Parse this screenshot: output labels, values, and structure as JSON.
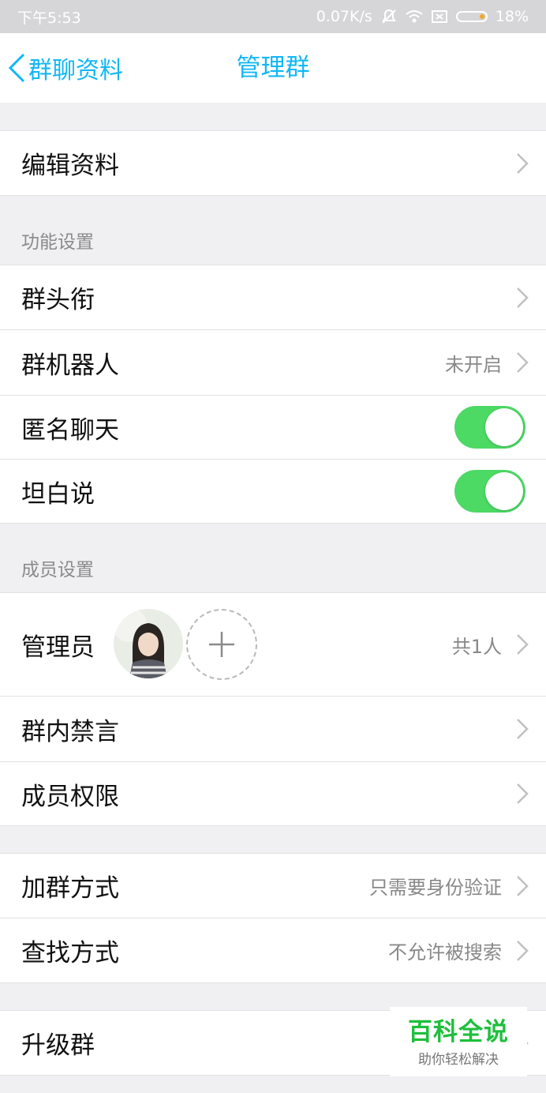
{
  "status_bar": {
    "time": "下午5:53",
    "network_speed": "0.07K/s",
    "battery_percent": "18%",
    "icons": [
      "mute-icon",
      "wifi-icon",
      "sim-icon",
      "battery-icon"
    ]
  },
  "nav": {
    "back_label": "群聊资料",
    "title": "管理群",
    "accent_color": "#12b7f5"
  },
  "edit_profile": {
    "label": "编辑资料"
  },
  "function_section": {
    "header": "功能设置",
    "items": [
      {
        "label": "群头衔",
        "value": ""
      },
      {
        "label": "群机器人",
        "value": "未开启"
      },
      {
        "label": "匿名聊天",
        "toggle_on": true
      },
      {
        "label": "坦白说",
        "toggle_on": true
      }
    ]
  },
  "member_section": {
    "header": "成员设置",
    "admins": {
      "label": "管理员",
      "count_text": "共1人"
    },
    "items": [
      {
        "label": "群内禁言"
      },
      {
        "label": "成员权限"
      }
    ]
  },
  "join_section": {
    "items": [
      {
        "label": "加群方式",
        "value": "只需要身份验证"
      },
      {
        "label": "查找方式",
        "value": "不允许被搜索"
      }
    ]
  },
  "upgrade_section": {
    "items": [
      {
        "label": "升级群"
      }
    ]
  },
  "watermark": {
    "title": "百科全说",
    "subtitle": "助你轻松解决"
  },
  "colors": {
    "toggle_on": "#4cd964",
    "background": "#f0f0f2"
  }
}
